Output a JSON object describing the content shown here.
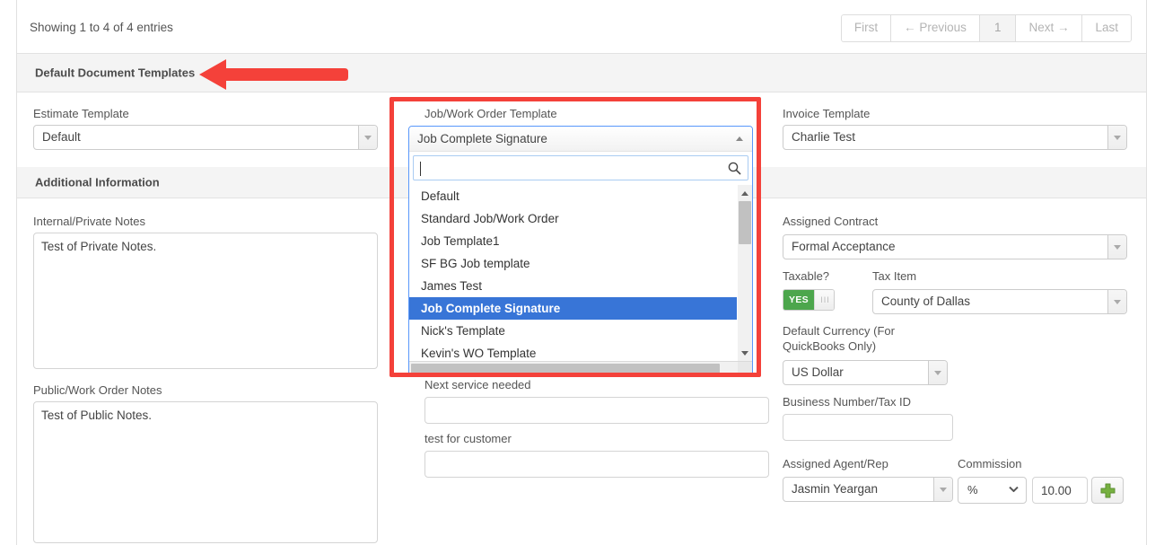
{
  "pagination": {
    "entries_text": "Showing 1 to 4 of 4 entries",
    "buttons": [
      {
        "label": "First",
        "current": false
      },
      {
        "label": "← Previous",
        "current": false
      },
      {
        "label": "1",
        "current": true
      },
      {
        "label": "Next →",
        "current": false
      },
      {
        "label": "Last",
        "current": false
      }
    ]
  },
  "sections": {
    "default_document_templates": "Default Document Templates",
    "additional_information": "Additional Information"
  },
  "templates": {
    "estimate": {
      "label": "Estimate Template",
      "value": "Default"
    },
    "job_work_order": {
      "label": "Job/Work Order Template",
      "value": "Job Complete Signature",
      "search_value": "",
      "search_placeholder": "",
      "options": [
        "Default",
        "Standard Job/Work Order",
        "Job Template1",
        "SF BG Job template",
        "James Test",
        "Job Complete Signature",
        "Nick's Template",
        "Kevin's WO Template"
      ],
      "selected_option": "Job Complete Signature"
    },
    "invoice": {
      "label": "Invoice Template",
      "value": "Charlie Test"
    }
  },
  "additional": {
    "internal_notes": {
      "label": "Internal/Private Notes",
      "value": "Test of Private Notes."
    },
    "public_notes": {
      "label": "Public/Work Order Notes",
      "value": "Test of Public Notes."
    },
    "next_service_needed": {
      "label": "Next service needed",
      "value": ""
    },
    "test_for_customer": {
      "label": "test for customer",
      "value": ""
    },
    "assigned_contract": {
      "label": "Assigned Contract",
      "value": "Formal Acceptance"
    },
    "taxable": {
      "label": "Taxable?",
      "state": "YES",
      "handle": "III"
    },
    "tax_item": {
      "label": "Tax Item",
      "value": "County of Dallas"
    },
    "default_currency": {
      "label": "Default Currency (For QuickBooks Only)",
      "value": "US Dollar"
    },
    "business_number": {
      "label": "Business Number/Tax ID",
      "value": ""
    },
    "assigned_agent": {
      "label": "Assigned Agent/Rep",
      "value": "Jasmin Yeargan"
    },
    "commission": {
      "label": "Commission",
      "type_value": "%",
      "amount_value": "10.00",
      "add_button": "+"
    }
  },
  "annotation": {
    "color": "#f4413a",
    "arrow_direction": "left",
    "highlight_target": "Job/Work Order Template dropdown"
  },
  "colors": {
    "accent_blue": "#3875d7",
    "focus_blue": "#5897fb",
    "toggle_green": "#4ca64c",
    "annotation_red": "#f4413a",
    "section_bg": "#f4f4f4"
  }
}
